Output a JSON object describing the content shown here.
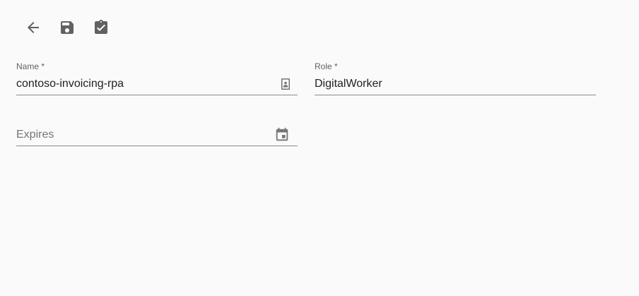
{
  "toolbar": {
    "back_icon": "arrow-back-icon",
    "save_icon": "save-icon",
    "assignment_icon": "assignment-turned-in-icon"
  },
  "form": {
    "name": {
      "label": "Name *",
      "value": "contoso-invoicing-rpa",
      "icon": "contact-badge-icon"
    },
    "role": {
      "label": "Role *",
      "value": "DigitalWorker"
    },
    "expires": {
      "placeholder": "Expires",
      "value": "",
      "icon": "calendar-icon"
    }
  },
  "colors": {
    "background": "#fafafa",
    "icon": "#616161",
    "text": "#212121",
    "label": "#616161",
    "underline": "#8a8a8a"
  }
}
